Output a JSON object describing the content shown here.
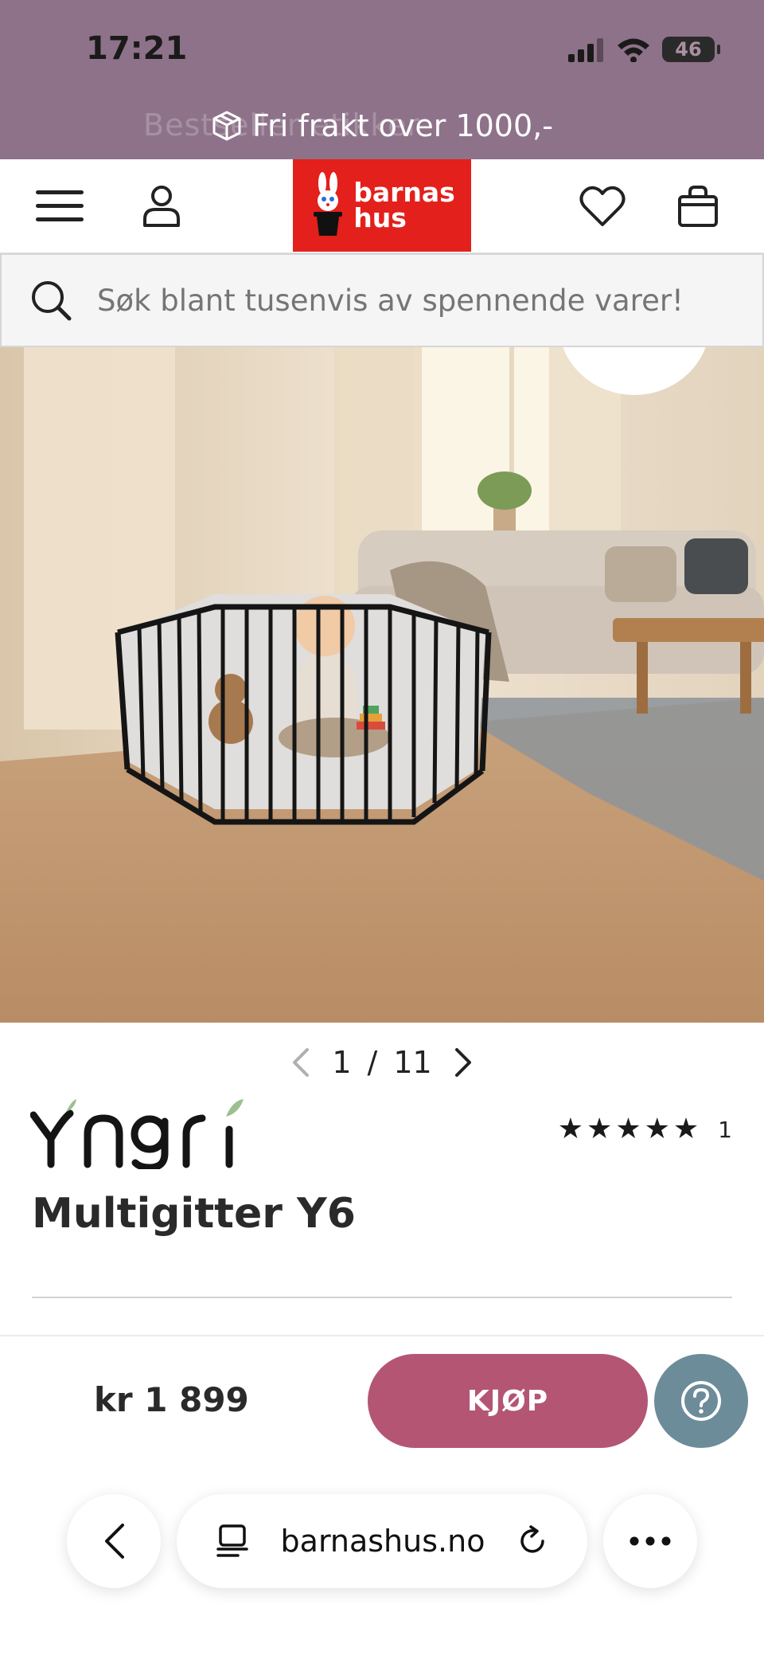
{
  "status_bar": {
    "time": "17:21",
    "battery": "46"
  },
  "promo": {
    "text": "Fri frakt over 1000,-",
    "ghost_text": "Bestseller etikker"
  },
  "header": {
    "logo_line1": "barnas",
    "logo_line2": "hus"
  },
  "search": {
    "placeholder": "Søk blant tusenvis av spennende varer!"
  },
  "gallery": {
    "current": "1",
    "separator": "/",
    "total": "11"
  },
  "product": {
    "brand": "Yngri",
    "title": "Multigitter Y6",
    "rating_stars": 5,
    "rating_count": "1",
    "price": "kr 1 899"
  },
  "buy_bar": {
    "buy_label": "KJØP"
  },
  "browser": {
    "url": "barnashus.no"
  },
  "colors": {
    "top_band": "#8e7289",
    "logo_red": "#e3201b",
    "buy_button": "#b45574",
    "help_button": "#6c8c9a"
  }
}
